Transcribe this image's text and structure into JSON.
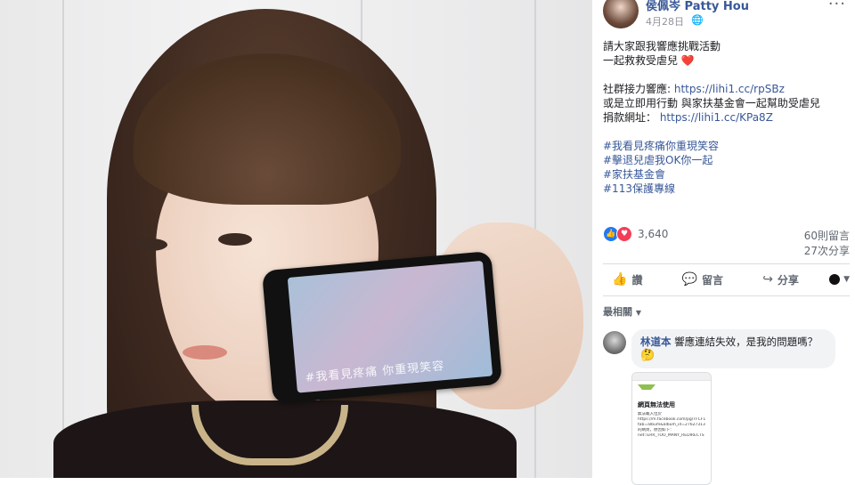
{
  "post": {
    "author": "侯佩岑 Patty Hou",
    "date": "4月28日",
    "more_label": "···",
    "lines": {
      "l1": "請大家跟我響應挑戰活動",
      "l2": "一起救救受虐兒",
      "l2_emoji": "❤️",
      "l3_prefix": "社群接力響應: ",
      "l3_link": "https://lihi1.cc/rpSBz",
      "l4": "或是立即用行動 與家扶基金會一起幫助受虐兒",
      "l5_prefix": "捐款網址： ",
      "l5_link": "https://lihi1.cc/KPa8Z"
    },
    "hashtags": [
      "#我看見疼痛你重現笑容",
      "#擊退兒虐我OK你一起",
      "#家扶基金會",
      "#113保護專線"
    ]
  },
  "photo": {
    "phone_caption": "#我看見疼痛 你重現笑容"
  },
  "stats": {
    "reactions": "3,640",
    "comments": "60則留言",
    "shares": "27次分享"
  },
  "actions": {
    "like": "讚",
    "comment": "留言",
    "share": "分享"
  },
  "comments": {
    "sort_label": "最相關",
    "items": [
      {
        "author": "林道本",
        "text": "響應連結失效，是我的問題嗎？",
        "emoji": "🤔",
        "screenshot": {
          "title": "網頁無法使用",
          "lines": [
            "無法載入位於",
            "https://m.facebook.com/pg/TFCF1/photos",
            "tab=album&album_id=276273130468543",
            "的網頁，原因如下：",
            "",
            "net::ERR_TOO_MANY_REDIRECTS"
          ]
        }
      }
    ]
  },
  "colors": {
    "link": "#385898",
    "like_blue": "#2078f4",
    "love_red": "#f33e58",
    "muted": "#606770"
  }
}
